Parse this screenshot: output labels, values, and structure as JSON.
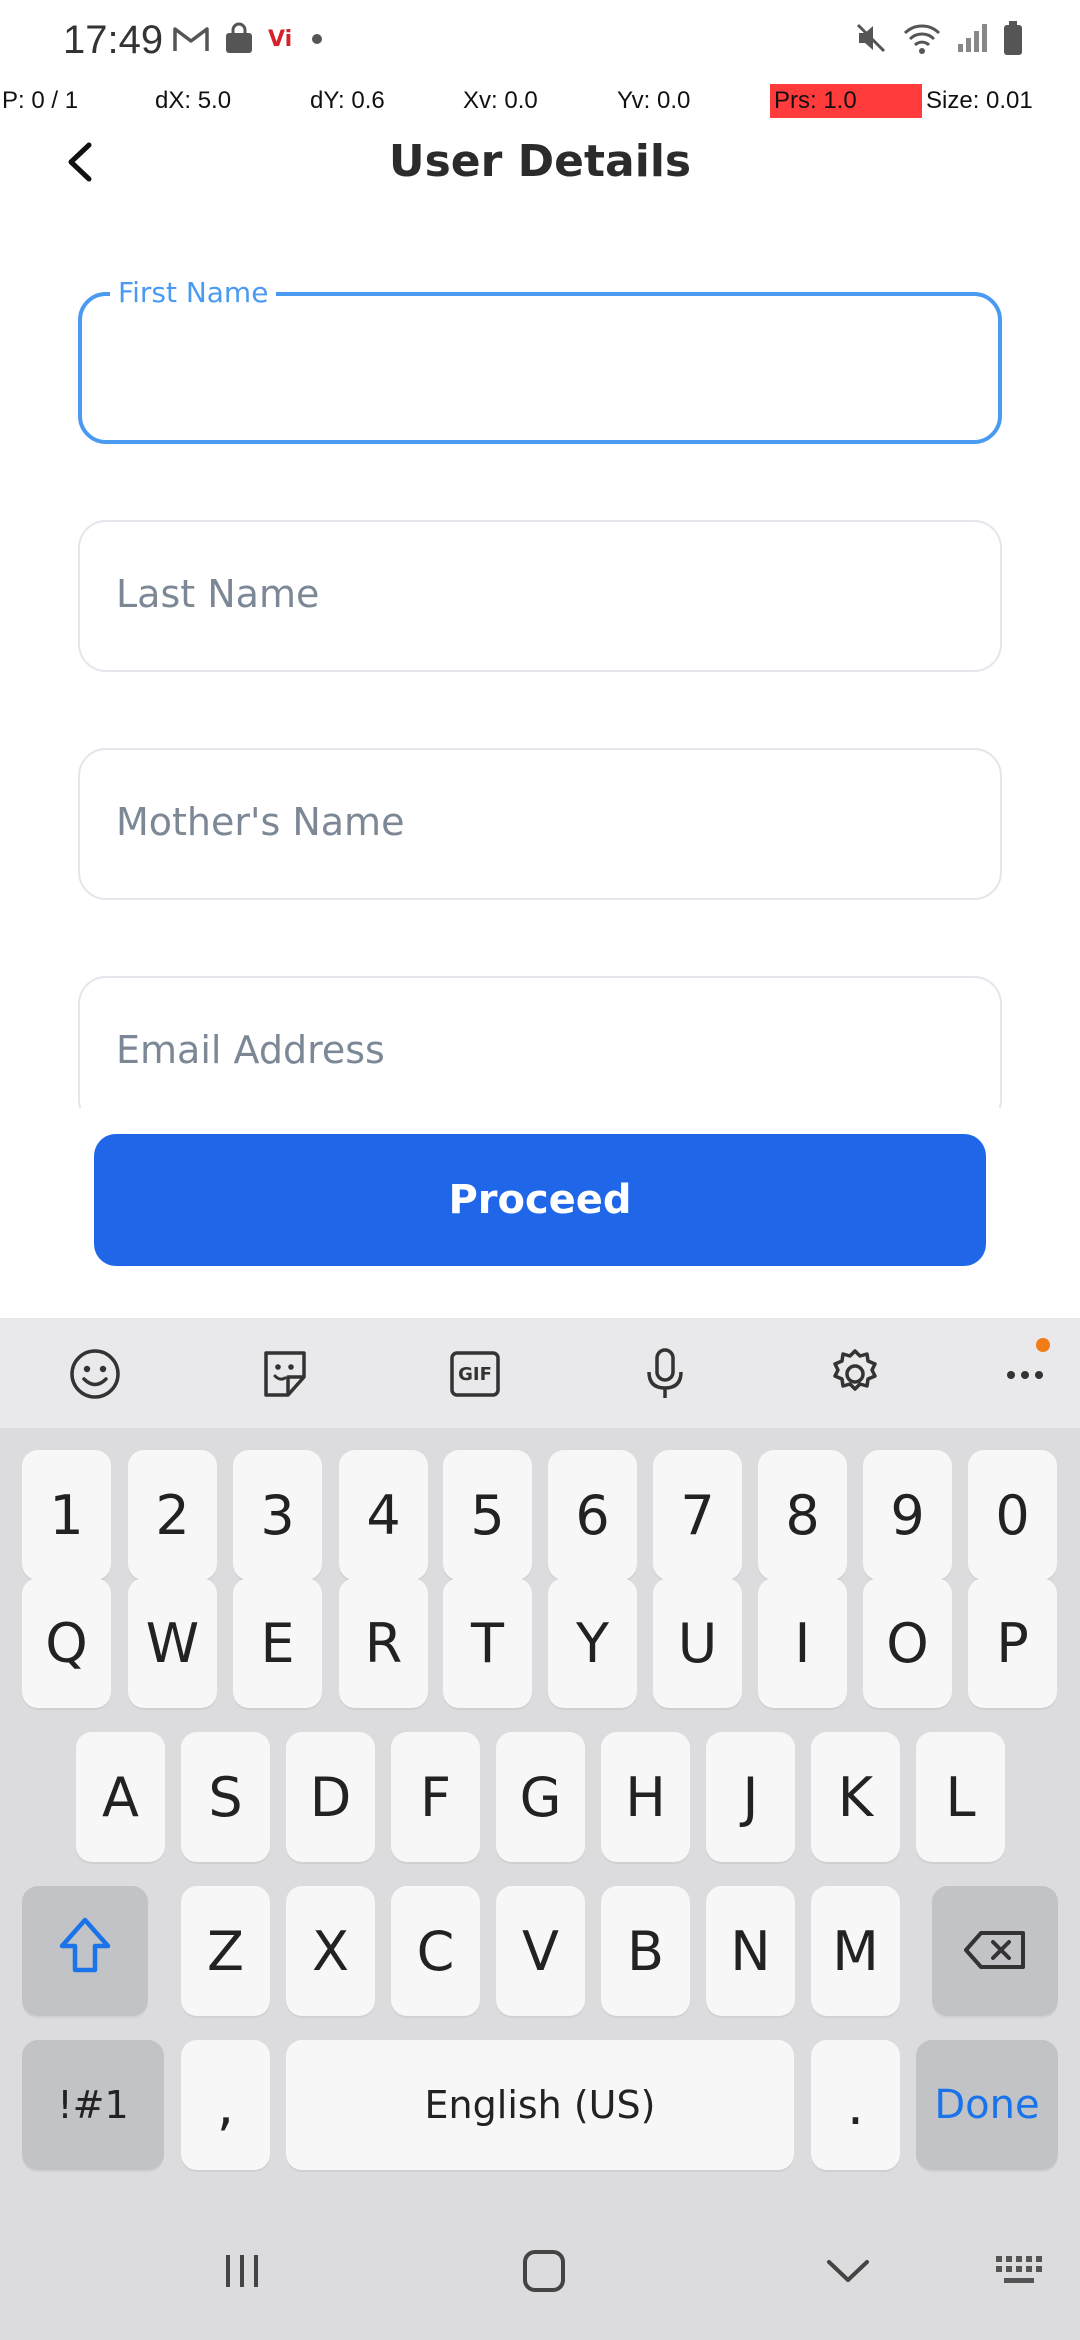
{
  "status_bar": {
    "time": "17:49",
    "left_icons": [
      "gmail-icon",
      "shopping-bag-icon",
      "vi-carrier-icon",
      "dot-icon"
    ],
    "carrier_badge": "Vi",
    "right_icons": [
      "mute-icon",
      "wifi-icon",
      "signal-icon",
      "battery-icon"
    ]
  },
  "pointer_overlay": {
    "p": "P: 0 / 1",
    "dx": "dX: 5.0",
    "dy": "dY: 0.6",
    "xv": "Xv: 0.0",
    "yv": "Yv: 0.0",
    "prs": "Prs: 1.0",
    "size": "Size: 0.01",
    "prs_color": "#ff3b3b"
  },
  "header": {
    "back_icon": "chevron-left-icon",
    "title": "User Details"
  },
  "form": {
    "fields": [
      {
        "label": "First Name",
        "value": "",
        "focused": true
      },
      {
        "label": "Last Name",
        "value": "",
        "focused": false
      },
      {
        "label": "Mother's Name",
        "value": "",
        "focused": false
      },
      {
        "label": "Email Address",
        "value": "",
        "focused": false
      }
    ],
    "focus_color": "#4a9af2"
  },
  "proceed": {
    "label": "Proceed",
    "color": "#1f67e8"
  },
  "keyboard": {
    "toolbar_icons": [
      "emoji-icon",
      "sticker-icon",
      "gif-icon",
      "microphone-icon",
      "settings-icon",
      "more-icon"
    ],
    "gif_label": "GIF",
    "row_numbers": [
      "1",
      "2",
      "3",
      "4",
      "5",
      "6",
      "7",
      "8",
      "9",
      "0"
    ],
    "row_q": [
      "Q",
      "W",
      "E",
      "R",
      "T",
      "Y",
      "U",
      "I",
      "O",
      "P"
    ],
    "row_a": [
      "A",
      "S",
      "D",
      "F",
      "G",
      "H",
      "J",
      "K",
      "L"
    ],
    "row_z": [
      "Z",
      "X",
      "C",
      "V",
      "B",
      "N",
      "M"
    ],
    "symbols_key": "!#1",
    "comma_key": ",",
    "space_key": "English (US)",
    "period_key": ".",
    "done_key": "Done",
    "accent_color": "#1a73e8"
  },
  "navbar": {
    "icons": [
      "recents-icon",
      "home-icon",
      "back-chevron-icon",
      "keyboard-switch-icon"
    ]
  }
}
